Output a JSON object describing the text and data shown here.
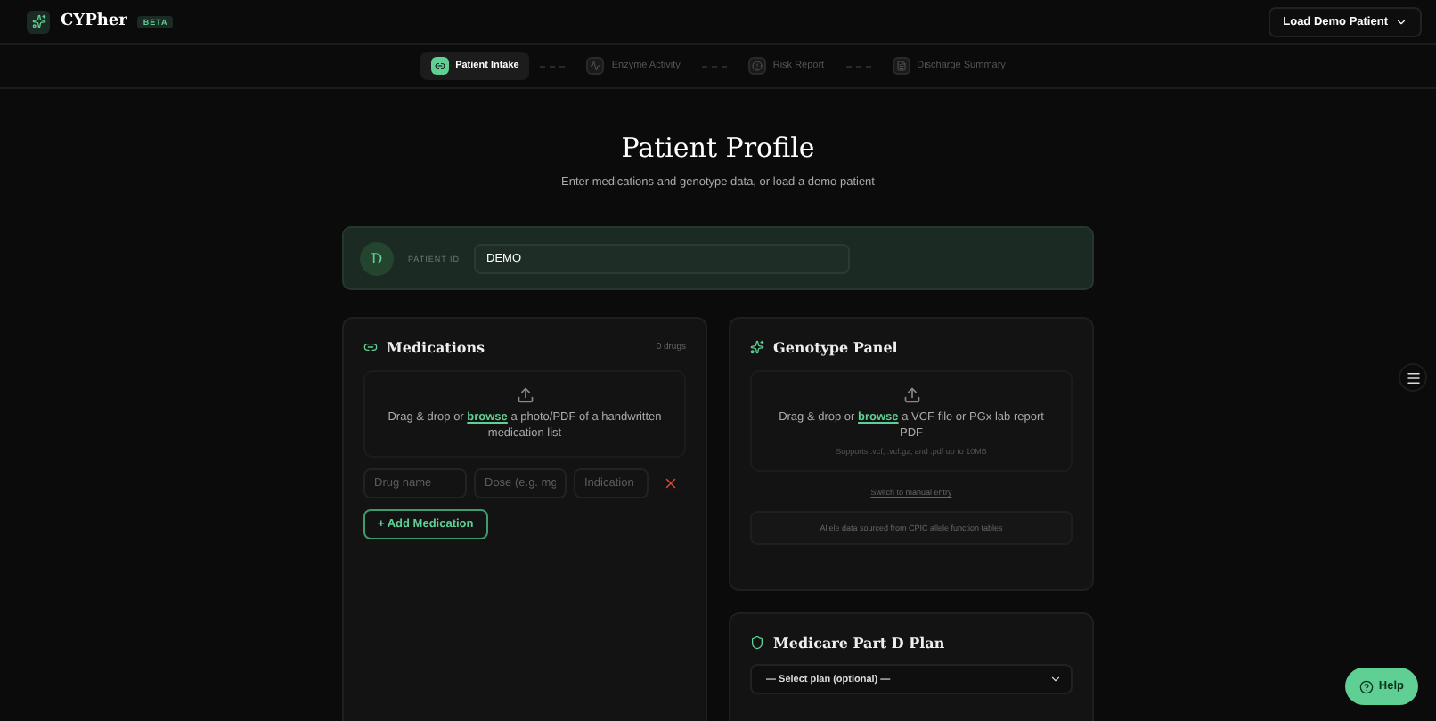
{
  "app": {
    "name": "CYPher",
    "badge": "BETA",
    "load_button": "Load Demo Patient"
  },
  "steps": [
    {
      "label": "Patient Intake",
      "selected": true
    },
    {
      "label": "Enzyme Activity",
      "selected": false
    },
    {
      "label": "Risk Report",
      "selected": false
    },
    {
      "label": "Discharge Summary",
      "selected": false
    }
  ],
  "page": {
    "title": "Patient Profile",
    "subtitle": "Enter medications and genotype data, or load a demo patient"
  },
  "patient": {
    "avatar": "D",
    "label": "PATIENT ID",
    "value": "DEMO"
  },
  "medications": {
    "title": "Medications",
    "count": "0 drugs",
    "link": "browse",
    "drop_before": "Drag & drop or ",
    "drop_after": " a photo/PDF of a handwritten medication list",
    "fields": [
      {
        "placeholder": "Drug name"
      },
      {
        "placeholder": "Dose (e.g. mg"
      },
      {
        "placeholder": "Indication"
      }
    ],
    "add_button": "+ Add Medication"
  },
  "genotype": {
    "title": "Genotype Panel",
    "drop_before": "Drag & drop or ",
    "link": "browse",
    "drop_after": " a VCF file or PGx lab report PDF",
    "hint": "Supports .vcf, .vcf.gz, and .pdf up to 10MB",
    "manual_link": "Switch to manual entry",
    "note": "Allele data sourced from CPIC allele function tables"
  },
  "medicare": {
    "title": "Medicare Part D Plan",
    "select": "— Select plan (optional) —"
  },
  "help_button": "Help"
}
